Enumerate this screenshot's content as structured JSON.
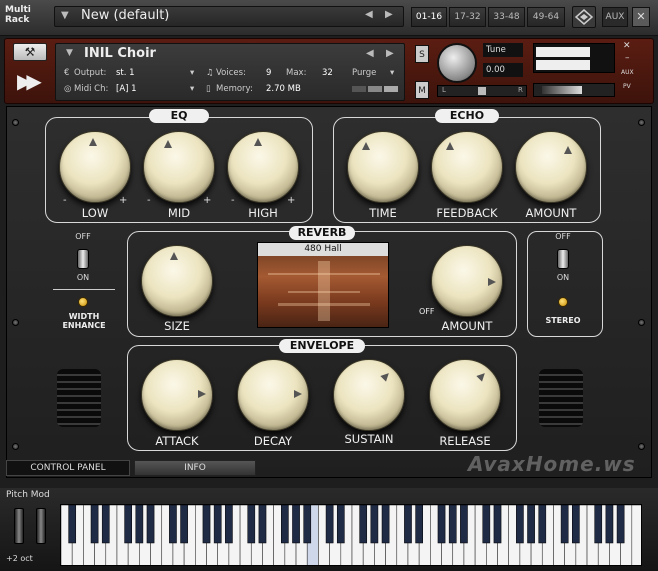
{
  "rack": {
    "label_line1": "Multi",
    "label_line2": "Rack",
    "preset_name": "New (default)",
    "page_tabs": [
      "01-16",
      "17-32",
      "33-48",
      "49-64"
    ],
    "active_tab": "01-16",
    "aux_label": "AUX"
  },
  "instrument": {
    "name": "INIL Choir",
    "output_label": "Output:",
    "output_value": "st. 1",
    "midi_label": "Midi Ch:",
    "midi_value": "[A]  1",
    "voices_label": "Voices:",
    "voices_value": "9",
    "max_label": "Max:",
    "max_value": "32",
    "purge_label": "Purge",
    "memory_label": "Memory:",
    "memory_value": "2.70 MB",
    "solo_label": "S",
    "mute_label": "M",
    "tune_label": "Tune",
    "tune_value": "0.00",
    "pan_left": "L",
    "pan_right": "R",
    "aux_side": "AUX",
    "pv_side": "PV"
  },
  "eq": {
    "title": "EQ",
    "knobs": [
      {
        "label": "LOW",
        "minus": "-",
        "plus": "+"
      },
      {
        "label": "MID",
        "minus": "-",
        "plus": "+"
      },
      {
        "label": "HIGH",
        "minus": "-",
        "plus": "+"
      }
    ]
  },
  "echo": {
    "title": "ECHO",
    "knobs": [
      {
        "label": "TIME"
      },
      {
        "label": "FEEDBACK"
      },
      {
        "label": "AMOUNT"
      }
    ]
  },
  "reverb": {
    "title": "REVERB",
    "image_title": "480 Hall",
    "size_label": "SIZE",
    "amount_label": "AMOUNT",
    "off_label": "OFF"
  },
  "envelope": {
    "title": "ENVELOPE",
    "knobs": [
      {
        "label": "ATTACK"
      },
      {
        "label": "DECAY"
      },
      {
        "label": "SUSTAIN"
      },
      {
        "label": "RELEASE"
      }
    ]
  },
  "width_switch": {
    "off": "OFF",
    "on": "ON",
    "led_line1": "WIDTH",
    "led_line2": "ENHANCE"
  },
  "stereo_switch": {
    "off": "OFF",
    "on": "ON",
    "led_label": "STEREO"
  },
  "tabs": {
    "control_panel": "CONTROL PANEL",
    "info": "INFO"
  },
  "watermark": "AvaxHome.ws",
  "keyboard": {
    "pitch_mod_label": "Pitch Mod",
    "octave_label": "+2 oct"
  }
}
